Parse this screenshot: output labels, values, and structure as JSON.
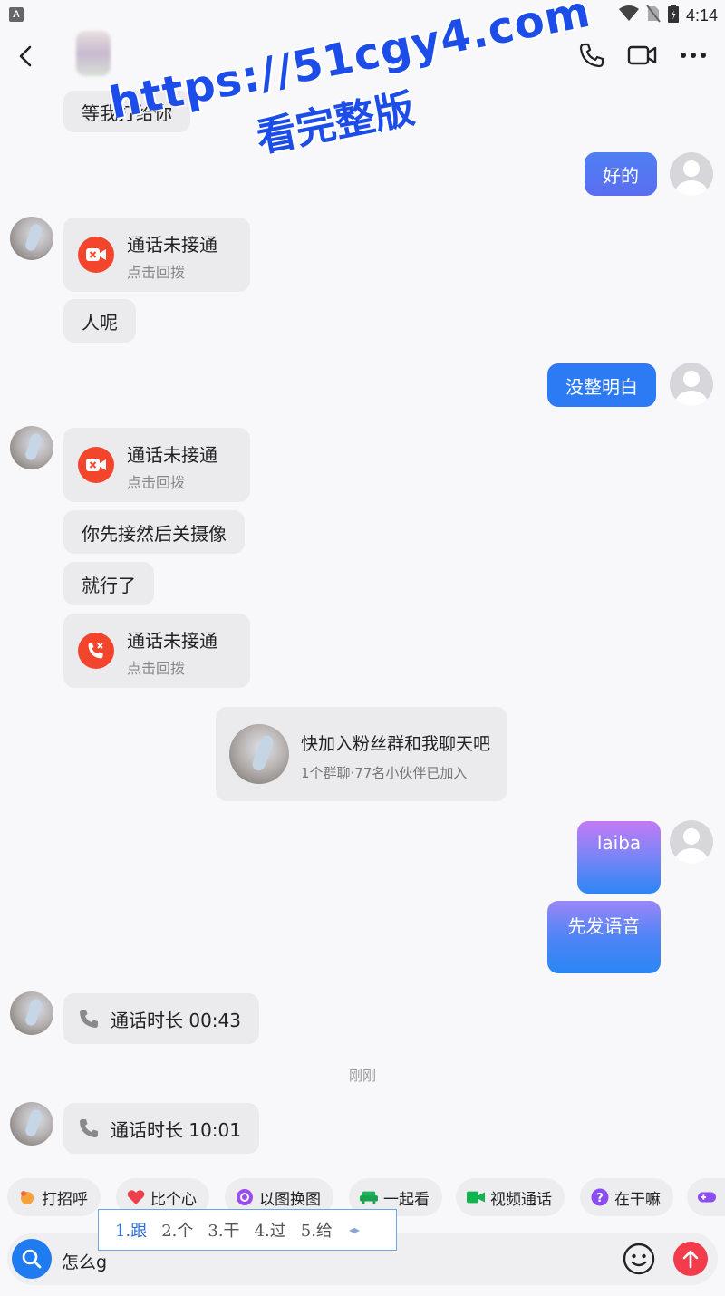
{
  "status_bar": {
    "time": "4:14",
    "left_icon_letter": "A"
  },
  "header": {
    "icons": [
      "back-icon",
      "phone-icon",
      "video-icon",
      "more-icon"
    ]
  },
  "watermark": {
    "line1": "https://51cgy4.com",
    "line2": "看完整版"
  },
  "messages": {
    "m1": "等我打给你",
    "m2": "好的",
    "call1": {
      "title": "通话未接通",
      "sub": "点击回拨"
    },
    "m3": "人呢",
    "m4": "没整明白",
    "call2": {
      "title": "通话未接通",
      "sub": "点击回拨"
    },
    "m5": "你先接然后关摄像",
    "m6": "就行了",
    "call3": {
      "title": "通话未接通",
      "sub": "点击回拨"
    },
    "group": {
      "title": "快加入粉丝群和我聊天吧",
      "sub": "1个群聊·77名小伙伴已加入"
    },
    "m7": "laiba",
    "m8": "先发语音",
    "dur1": "通话时长 00:43",
    "time_label": "刚刚",
    "dur2": "通话时长 10:01"
  },
  "quick_actions": [
    "打招呼",
    "比个心",
    "以图换图",
    "一起看",
    "视频通话",
    "在干嘛"
  ],
  "ime": {
    "candidates": [
      "1.跟",
      "2.个",
      "3.干",
      "4.过",
      "5.给"
    ]
  },
  "input": {
    "text": "怎么g"
  },
  "colors": {
    "accent_blue": "#2d7bf4",
    "missed_call_red": "#f2452c",
    "send_red": "#f23b4b",
    "watermark_blue": "#1c4de8"
  }
}
